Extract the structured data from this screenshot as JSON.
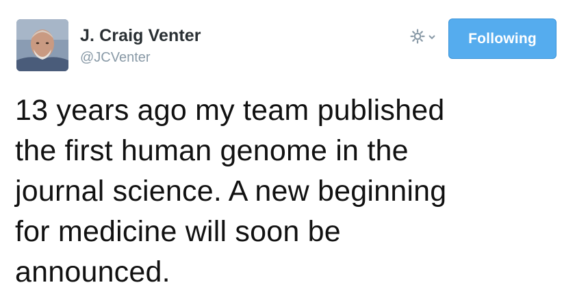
{
  "author": {
    "display_name": "J. Craig Venter",
    "handle": "@JCVenter",
    "avatar_icon": "profile-photo"
  },
  "actions": {
    "gear_icon": "gear-icon",
    "chevron_icon": "chevron-down-icon",
    "follow_label": "Following",
    "follow_color": "#55acee"
  },
  "tweet": {
    "text": "13 years ago my team published\nthe first human genome in the\njournal science. A new beginning\nfor medicine will soon be\nannounced."
  }
}
